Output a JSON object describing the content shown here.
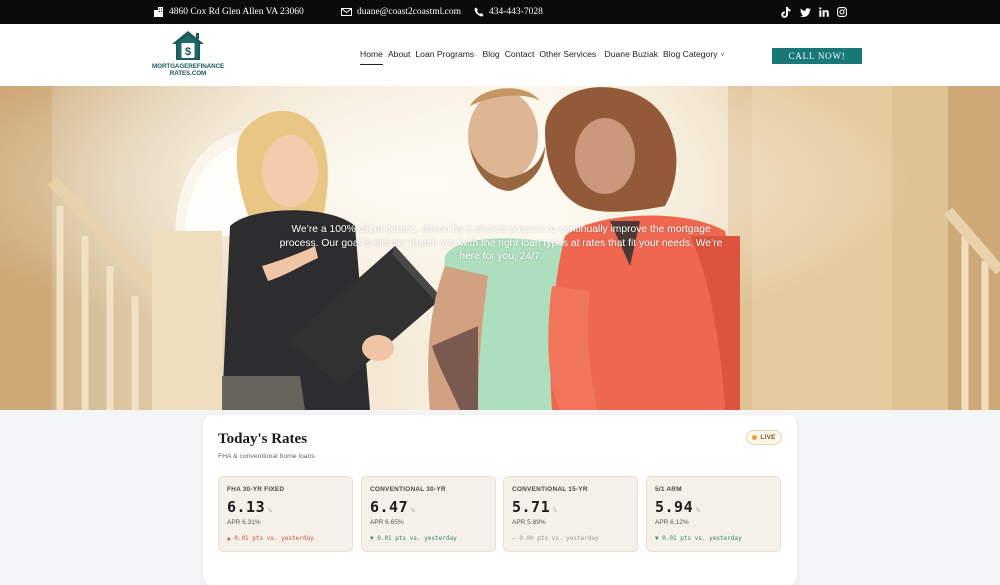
{
  "topbar": {
    "address": "4860 Cox Rd Glen Allen VA 23060",
    "email": "duane@coast2coastml.com",
    "phone": "434-443-7028",
    "socials": [
      "tiktok-icon",
      "twitter-icon",
      "linkedin-icon",
      "instagram-icon"
    ]
  },
  "header": {
    "logo_line1": "MORTGAGEREFINANCE",
    "logo_line2": "RATES.COM",
    "nav": [
      {
        "label": "Home",
        "dropdown": false
      },
      {
        "label": "About",
        "dropdown": false
      },
      {
        "label": "Loan Programs",
        "dropdown": true
      },
      {
        "label": "Blog",
        "dropdown": false
      },
      {
        "label": "Contact",
        "dropdown": false
      },
      {
        "label": "Other Services",
        "dropdown": true
      },
      {
        "label": "Duane Buziak",
        "dropdown": false
      },
      {
        "label": "Blog Category",
        "dropdown": true
      }
    ],
    "cta_label": "CALL NOW!",
    "colors": {
      "brand": "#187777",
      "logo": "#1c5b5b"
    }
  },
  "hero": {
    "text": "We’re a 100% client centric, driven by a shared passion to continually improve the mortgage process. Our goal is simple: match you with the right loan types at rates that fit your needs. We’re here for you, 24/7."
  },
  "rates": {
    "title": "Today's Rates",
    "subtitle": "FHA & conventional home loans",
    "live_label": "LIVE",
    "items": [
      {
        "label": "FHA 30-YR FIXED",
        "value": "6.13",
        "unit": "%",
        "apr": "APR 6.31%",
        "change": "▲ 0.01 pts vs. yesterday",
        "trend": "up"
      },
      {
        "label": "CONVENTIONAL 30-YR",
        "value": "6.47",
        "unit": "%",
        "apr": "APR 6.65%",
        "change": "▼ 0.01 pts vs. yesterday",
        "trend": "down"
      },
      {
        "label": "CONVENTIONAL 15-YR",
        "value": "5.71",
        "unit": "%",
        "apr": "APR 5.89%",
        "change": "— 0.00 pts vs. yesterday",
        "trend": "flat"
      },
      {
        "label": "5/1 ARM",
        "value": "5.94",
        "unit": "%",
        "apr": "APR 6.12%",
        "change": "▼ 0.01 pts vs. yesterday",
        "trend": "down"
      }
    ]
  }
}
